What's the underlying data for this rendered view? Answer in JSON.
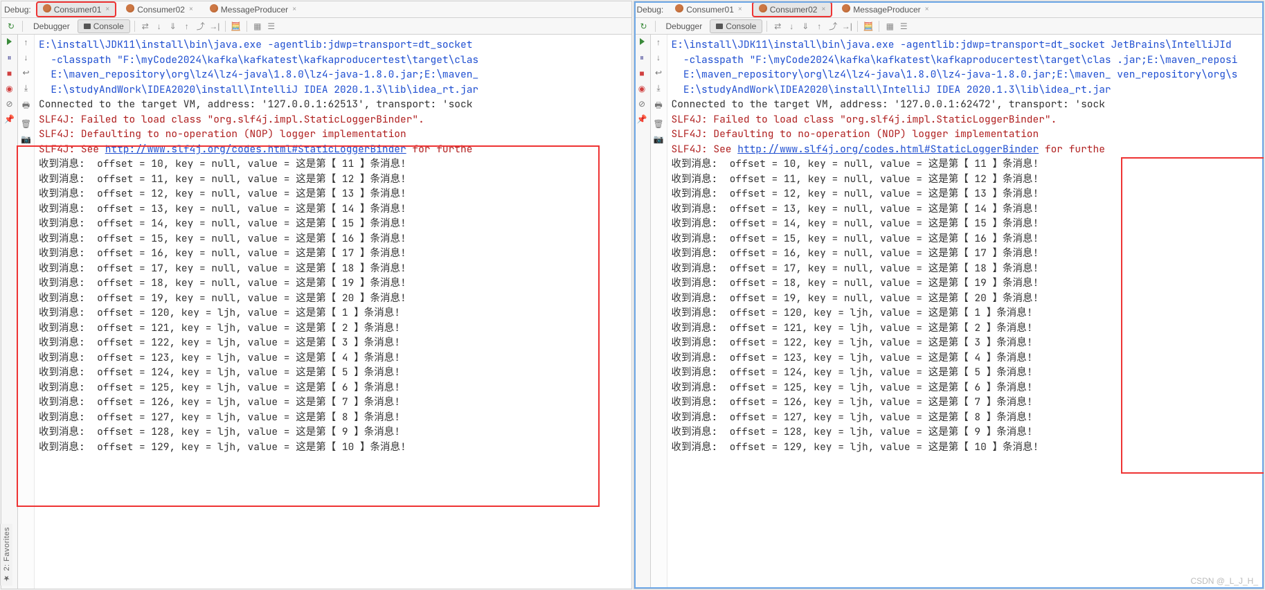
{
  "left_vertical_label": "★ 2: Favorites",
  "watermark": "CSDN @_L_J_H_",
  "debug_label": "Debug:",
  "tabs": [
    {
      "name": "Consumer01"
    },
    {
      "name": "Consumer02"
    },
    {
      "name": "MessageProducer"
    }
  ],
  "sub": {
    "debugger": "Debugger",
    "console": "Console"
  },
  "panes": [
    {
      "active_tab_index": 0,
      "highlight_tab_index": 0,
      "port": "62513",
      "pane_class": "left"
    },
    {
      "active_tab_index": 1,
      "highlight_tab_index": 1,
      "port": "62472",
      "pane_class": "right"
    }
  ],
  "console_header_lines": [
    {
      "cls": "blue",
      "text": "E:\\install\\JDK11\\install\\bin\\java.exe -agentlib:jdwp=transport=dt_socket"
    },
    {
      "cls": "blue",
      "text": "  -classpath \"F:\\myCode2024\\kafka\\kafkatest\\kafkaproducertest\\target\\clas"
    },
    {
      "cls": "blue",
      "text": "  E:\\maven_repository\\org\\lz4\\lz4-java\\1.8.0\\lz4-java-1.8.0.jar;E:\\maven_"
    },
    {
      "cls": "blue",
      "text": "  E:\\studyAndWork\\IDEA2020\\install\\IntelliJ IDEA 2020.1.3\\lib\\idea_rt.jar"
    }
  ],
  "console_header_right_overflow": [
    "JetBrains\\IntelliJId",
    ".jar;E:\\maven_reposi",
    "ven_repository\\org\\s",
    ""
  ],
  "connected_prefix": "Connected to the target VM, address: '127.0.0.1:",
  "connected_suffix": "', transport: 'sock",
  "slf4j_lines": [
    "SLF4J: Failed to load class \"org.slf4j.impl.StaticLoggerBinder\".",
    "SLF4J: Defaulting to no-operation (NOP) logger implementation"
  ],
  "slf4j_see_pre": "SLF4J: See ",
  "slf4j_see_link": "http://www.slf4j.org/codes.html#StaticLoggerBinder",
  "slf4j_see_post": " for furthe",
  "msg_prefix": "收到消息:  offset = ",
  "msg_key_part": ", key = ",
  "msg_value_part": ", value = 这是第【 ",
  "msg_suffix": " 】条消息!",
  "messages": [
    {
      "offset": 10,
      "key": "null",
      "n": 11
    },
    {
      "offset": 11,
      "key": "null",
      "n": 12
    },
    {
      "offset": 12,
      "key": "null",
      "n": 13
    },
    {
      "offset": 13,
      "key": "null",
      "n": 14
    },
    {
      "offset": 14,
      "key": "null",
      "n": 15
    },
    {
      "offset": 15,
      "key": "null",
      "n": 16
    },
    {
      "offset": 16,
      "key": "null",
      "n": 17
    },
    {
      "offset": 17,
      "key": "null",
      "n": 18
    },
    {
      "offset": 18,
      "key": "null",
      "n": 19
    },
    {
      "offset": 19,
      "key": "null",
      "n": 20
    },
    {
      "offset": 120,
      "key": "ljh",
      "n": 1
    },
    {
      "offset": 121,
      "key": "ljh",
      "n": 2
    },
    {
      "offset": 122,
      "key": "ljh",
      "n": 3
    },
    {
      "offset": 123,
      "key": "ljh",
      "n": 4
    },
    {
      "offset": 124,
      "key": "ljh",
      "n": 5
    },
    {
      "offset": 125,
      "key": "ljh",
      "n": 6
    },
    {
      "offset": 126,
      "key": "ljh",
      "n": 7
    },
    {
      "offset": 127,
      "key": "ljh",
      "n": 8
    },
    {
      "offset": 128,
      "key": "ljh",
      "n": 9
    },
    {
      "offset": 129,
      "key": "ljh",
      "n": 10
    }
  ]
}
